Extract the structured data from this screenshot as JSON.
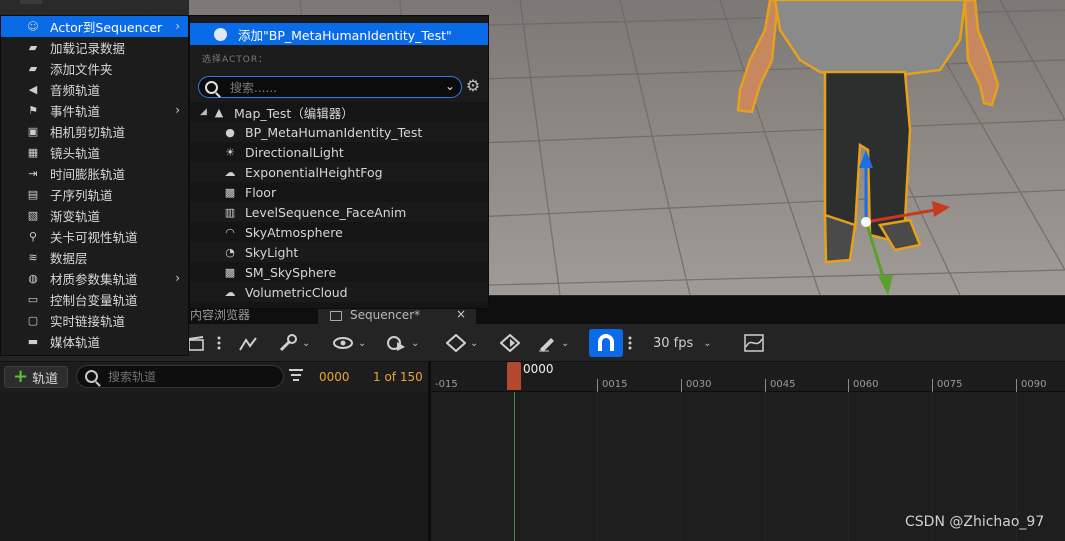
{
  "context_menu": {
    "items": [
      {
        "label": "Actor到Sequencer",
        "icon": "actor-icon",
        "submenu": true,
        "active": true
      },
      {
        "label": "加载记录数据",
        "icon": "folder-icon",
        "submenu": false
      },
      {
        "label": "添加文件夹",
        "icon": "folder-icon",
        "submenu": false
      },
      {
        "label": "音频轨道",
        "icon": "speaker-icon",
        "submenu": false
      },
      {
        "label": "事件轨道",
        "icon": "flag-icon",
        "submenu": true
      },
      {
        "label": "相机剪切轨道",
        "icon": "camera-icon",
        "submenu": false
      },
      {
        "label": "镜头轨道",
        "icon": "film-icon",
        "submenu": false
      },
      {
        "label": "时间膨胀轨道",
        "icon": "dilation-icon",
        "submenu": false
      },
      {
        "label": "子序列轨道",
        "icon": "subsequence-icon",
        "submenu": false
      },
      {
        "label": "渐变轨道",
        "icon": "fade-icon",
        "submenu": false
      },
      {
        "label": "关卡可视性轨道",
        "icon": "level-visibility-icon",
        "submenu": false
      },
      {
        "label": "数据层",
        "icon": "layers-icon",
        "submenu": false
      },
      {
        "label": "材质参数集轨道",
        "icon": "material-icon",
        "submenu": true
      },
      {
        "label": "控制台变量轨道",
        "icon": "console-icon",
        "submenu": false
      },
      {
        "label": "实时链接轨道",
        "icon": "livelink-icon",
        "submenu": false
      },
      {
        "label": "媒体轨道",
        "icon": "media-icon",
        "submenu": false
      }
    ]
  },
  "actor_submenu": {
    "add_label": "添加\"BP_MetaHumanIdentity_Test\"",
    "section_title": "选择ACTOR：",
    "search_placeholder": "搜索......",
    "tree": {
      "root": "Map_Test（编辑器）",
      "children": [
        {
          "label": "BP_MetaHumanIdentity_Test",
          "icon": "blueprint-icon"
        },
        {
          "label": "DirectionalLight",
          "icon": "sun-icon"
        },
        {
          "label": "ExponentialHeightFog",
          "icon": "fog-icon"
        },
        {
          "label": "Floor",
          "icon": "mesh-icon"
        },
        {
          "label": "LevelSequence_FaceAnim",
          "icon": "sequence-icon"
        },
        {
          "label": "SkyAtmosphere",
          "icon": "atmosphere-icon"
        },
        {
          "label": "SkyLight",
          "icon": "skylight-icon"
        },
        {
          "label": "SM_SkySphere",
          "icon": "mesh-icon"
        },
        {
          "label": "VolumetricCloud",
          "icon": "cloud-icon"
        }
      ]
    }
  },
  "tabs": {
    "content_browser": "内容浏览器",
    "sequencer": "Sequencer*",
    "close": "×"
  },
  "toolbar": {
    "fps": "30 fps"
  },
  "track_panel": {
    "add_track": "轨道",
    "search_placeholder": "搜索轨道",
    "current_frame": "0000",
    "frame_range": "1 of 150"
  },
  "timeline": {
    "playhead_label": "0000",
    "ticks": [
      "-015",
      "0015",
      "0030",
      "0045",
      "0060",
      "0075",
      "0090"
    ],
    "playhead_color": "#b2492f"
  },
  "watermark": "CSDN @Zhichao_97",
  "colors": {
    "accent": "#0a6be8",
    "frame_text": "#e8a33b",
    "selection_outline": "#e6a11c"
  }
}
